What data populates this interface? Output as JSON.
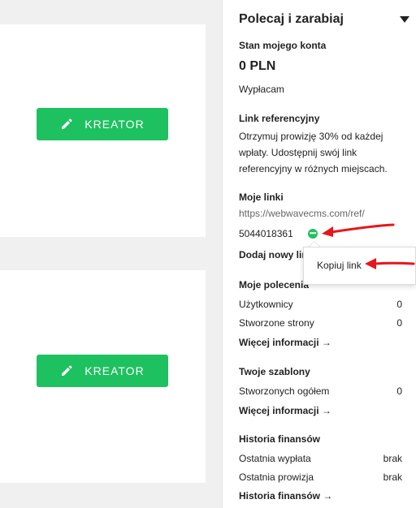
{
  "cards": [
    {
      "button_label": "KREATOR",
      "icon": "pencil-icon"
    },
    {
      "button_label": "KREATOR",
      "icon": "pencil-icon"
    }
  ],
  "panel": {
    "title": "Polecaj i zarabiaj",
    "account": {
      "heading": "Stan mojego konta",
      "balance": "0 PLN",
      "withdraw_label": "Wypłacam"
    },
    "referral": {
      "heading": "Link referencyjny",
      "description": "Otrzymuj prowizję 30% od każdej wpłaty. Udostępnij swój link referencyjny w różnych miejscach."
    },
    "links": {
      "heading": "Moje linki",
      "url": "https://webwavecms.com/ref/",
      "id": "5044018361",
      "add_label": "Dodaj nowy link"
    },
    "popup": {
      "copy_label": "Kopiuj link"
    },
    "referrals": {
      "heading": "Moje polecenia",
      "rows": [
        {
          "label": "Użytkownicy",
          "value": "0"
        },
        {
          "label": "Stworzone strony",
          "value": "0"
        }
      ],
      "more_label": "Więcej informacji →"
    },
    "templates": {
      "heading": "Twoje szablony",
      "rows": [
        {
          "label": "Stworzonych ogółem",
          "value": "0"
        }
      ],
      "more_label": "Więcej informacji →"
    },
    "finance": {
      "heading": "Historia finansów",
      "rows": [
        {
          "label": "Ostatnia wypłata",
          "value": "brak"
        },
        {
          "label": "Ostatnia prowizja",
          "value": "brak"
        }
      ],
      "more_label": "Historia finansów →"
    }
  },
  "colors": {
    "accent": "#1ec15f",
    "annotation": "#e8161b",
    "page_bg": "#f0f0f0"
  }
}
